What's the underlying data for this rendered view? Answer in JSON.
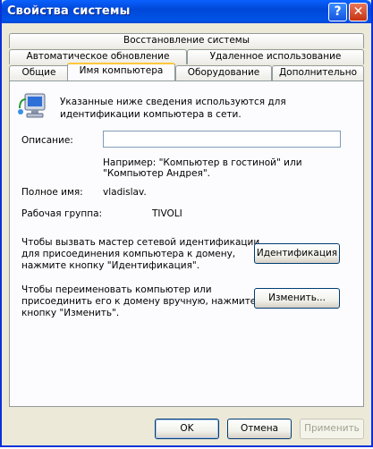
{
  "window": {
    "title": "Свойства системы",
    "help_glyph": "?",
    "close_glyph": "✕"
  },
  "tabs": {
    "row1": [
      "Восстановление системы"
    ],
    "row2": [
      "Автоматическое обновление",
      "Удаленное использование"
    ],
    "row3": [
      "Общие",
      "Имя компьютера",
      "Оборудование",
      "Дополнительно"
    ],
    "active": "Имя компьютера"
  },
  "panel": {
    "intro": [
      "Указанные ниже сведения используются для",
      "идентификации компьютера в сети."
    ],
    "description_label": "Описание:",
    "description_value": "",
    "example": [
      "Например: \"Компьютер в гостиной\" или",
      "\"Компьютер Андрея\"."
    ],
    "fullname_label": "Полное имя:",
    "fullname_value": "vladislav.",
    "workgroup_label": "Рабочая группа:",
    "workgroup_value": "TIVOLI",
    "wizard_text": [
      "Чтобы вызвать мастер сетевой идентификации",
      "для присоединения компьютера к домену,",
      "нажмите кнопку \"Идентификация\"."
    ],
    "identify_button": "Идентификация",
    "rename_text": [
      "Чтобы переименовать компьютер или",
      "присоединить его к домену вручную, нажмите",
      "кнопку \"Изменить\"."
    ],
    "change_button": "Изменить..."
  },
  "footer": {
    "ok": "OK",
    "cancel": "Отмена",
    "apply": "Применить"
  },
  "colors": {
    "titlebar": "#0053e7",
    "accent_tab": "#ffc83c",
    "face": "#ece9d8"
  },
  "icons": [
    "help-icon",
    "close-icon",
    "computer-network-icon"
  ]
}
